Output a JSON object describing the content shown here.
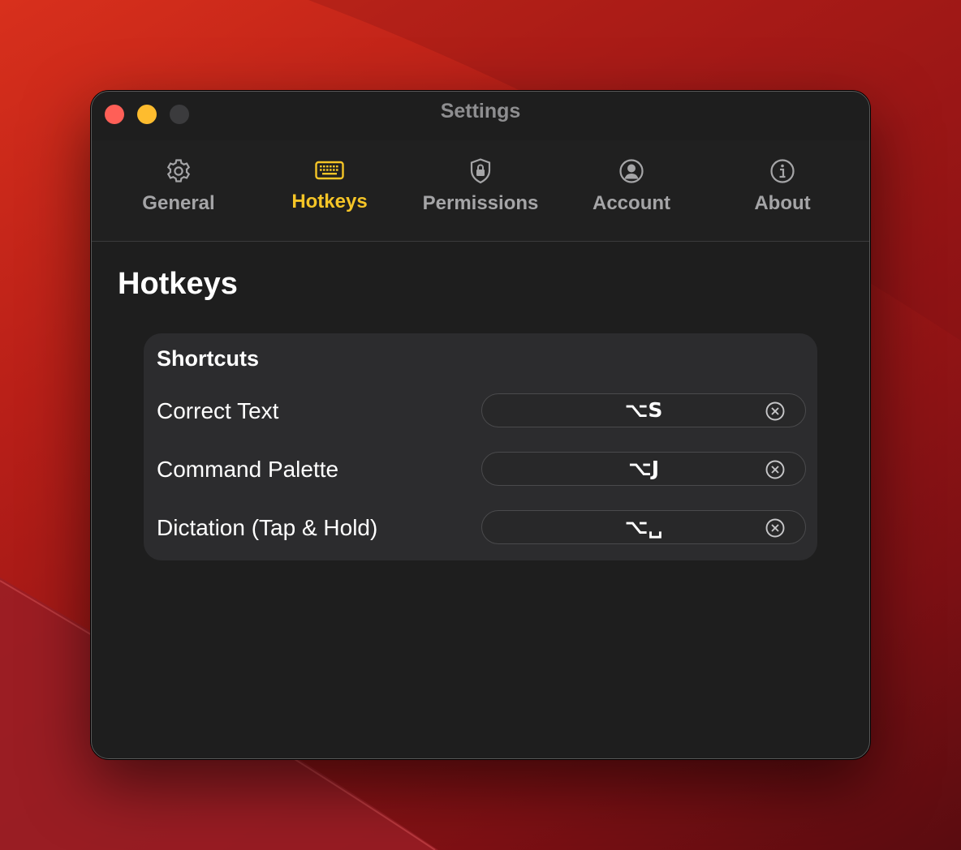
{
  "window": {
    "title": "Settings"
  },
  "tabs": [
    {
      "label": "General",
      "icon": "gear-icon"
    },
    {
      "label": "Hotkeys",
      "icon": "keyboard-icon",
      "active": true
    },
    {
      "label": "Permissions",
      "icon": "shield-lock-icon"
    },
    {
      "label": "Account",
      "icon": "person-circle-icon"
    },
    {
      "label": "About",
      "icon": "info-circle-icon"
    }
  ],
  "page": {
    "title": "Hotkeys"
  },
  "shortcuts": {
    "heading": "Shortcuts",
    "rows": [
      {
        "label": "Correct Text",
        "value": "⌥S"
      },
      {
        "label": "Command Palette",
        "value": "⌥J"
      },
      {
        "label": "Dictation (Tap & Hold)",
        "value": "⌥␣"
      }
    ]
  },
  "colors": {
    "accent": "#f5c527",
    "close": "#ff5f57",
    "minimize": "#febc2e",
    "window_bg": "#1e1e1e",
    "card_bg": "#2c2c2e"
  }
}
